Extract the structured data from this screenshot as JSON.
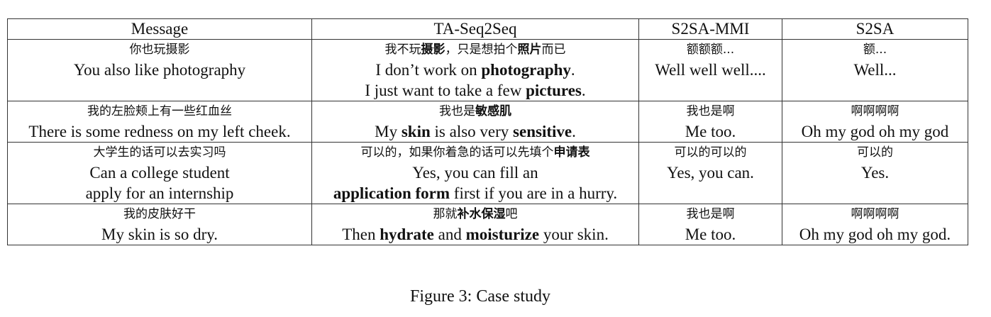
{
  "table": {
    "headers": [
      "Message",
      "TA-Seq2Seq",
      "S2SA-MMI",
      "S2SA"
    ],
    "rows": [
      {
        "message": {
          "zh": "你也玩摄影",
          "en": [
            "You also like photography"
          ]
        },
        "taseq": {
          "zh": {
            "a": "我不玩",
            "b": "摄影",
            "c": "，只是想拍个",
            "d": "照片",
            "e": "而已"
          },
          "en1": {
            "a": "I don’t work on ",
            "b": "photography",
            "c": "."
          },
          "en2": {
            "a": "I just want to take a few ",
            "b": "pictures",
            "c": "."
          }
        },
        "mmi": {
          "zh": "额额额...",
          "en": "Well well well...."
        },
        "s2sa": {
          "zh": "额...",
          "en": "Well..."
        }
      },
      {
        "message": {
          "zh": "我的左脸颊上有一些红血丝",
          "en": [
            "There is some redness on my left cheek."
          ]
        },
        "taseq": {
          "zh": {
            "a": "我也是",
            "b": "敏感肌"
          },
          "en1": {
            "a": "My ",
            "b": "skin",
            "c": " is also very ",
            "d": "sensitive",
            "e": "."
          }
        },
        "mmi": {
          "zh": "我也是啊",
          "en": "Me too."
        },
        "s2sa": {
          "zh": "啊啊啊啊",
          "en": "Oh my god oh my god"
        }
      },
      {
        "message": {
          "zh": "大学生的话可以去实习吗",
          "en": [
            "Can a college student",
            "apply for an internship"
          ]
        },
        "taseq": {
          "zh": {
            "a": "可以的，如果你着急的话可以先填个",
            "b": "申请表"
          },
          "en1": {
            "a": "Yes, you can fill an"
          },
          "en2": {
            "a": "application form",
            "b": " first if you are in a hurry."
          }
        },
        "mmi": {
          "zh": "可以的可以的",
          "en": "Yes, you can."
        },
        "s2sa": {
          "zh": "可以的",
          "en": "Yes."
        }
      },
      {
        "message": {
          "zh": "我的皮肤好干",
          "en": [
            "My skin is so dry."
          ]
        },
        "taseq": {
          "zh": {
            "a": "那就",
            "b": "补水保湿",
            "c": "吧"
          },
          "en1": {
            "a": "Then ",
            "b": "hydrate",
            "c": " and ",
            "d": "moisturize",
            "e": " your skin."
          }
        },
        "mmi": {
          "zh": "我也是啊",
          "en": "Me too."
        },
        "s2sa": {
          "zh": "啊啊啊啊",
          "en": "Oh my god oh my god."
        }
      }
    ]
  },
  "caption": "Figure 3: Case study"
}
